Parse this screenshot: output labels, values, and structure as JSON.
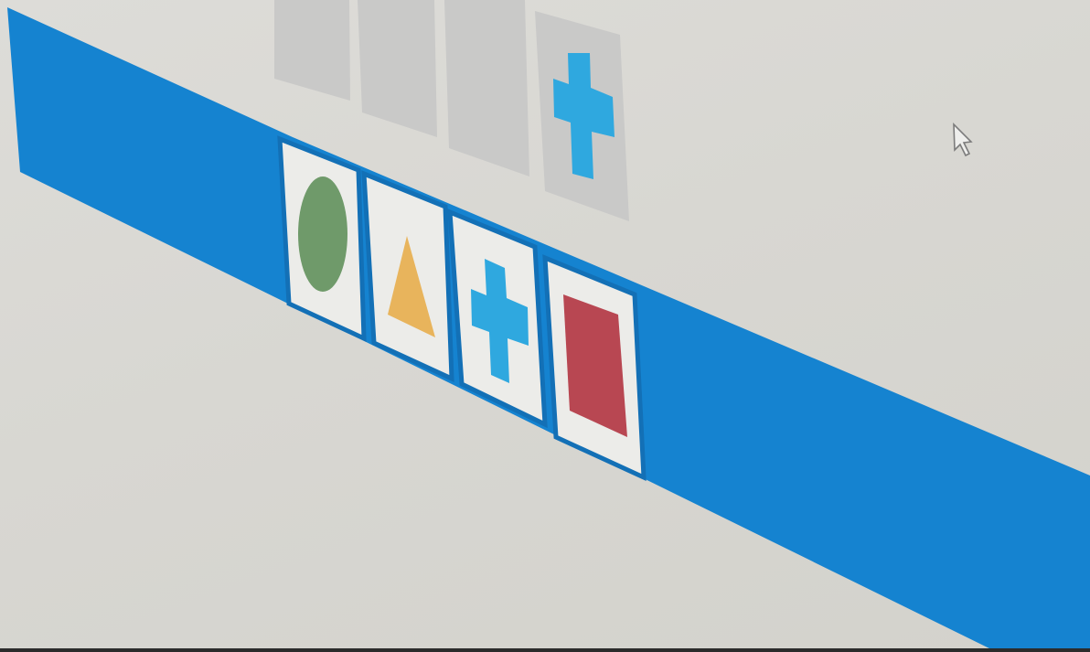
{
  "game": {
    "target_row": {
      "slots": [
        {
          "filled": false
        },
        {
          "filled": false
        },
        {
          "filled": false
        },
        {
          "filled": true,
          "shape": "cross",
          "color": "#2fa8df"
        }
      ]
    },
    "hand_row": {
      "cards": [
        {
          "shape": "circle",
          "color": "#6f9a6a"
        },
        {
          "shape": "triangle",
          "color": "#e8b45c"
        },
        {
          "shape": "cross",
          "color": "#2fa8df"
        },
        {
          "shape": "rectangle",
          "color": "#b84752"
        }
      ]
    },
    "colors": {
      "band": "#1583d0",
      "card_background": "#ecece9",
      "empty_slot": "#c9c9c8",
      "background": "#d9d8d4"
    },
    "cursor_icon": "arrow-pointer-icon"
  }
}
